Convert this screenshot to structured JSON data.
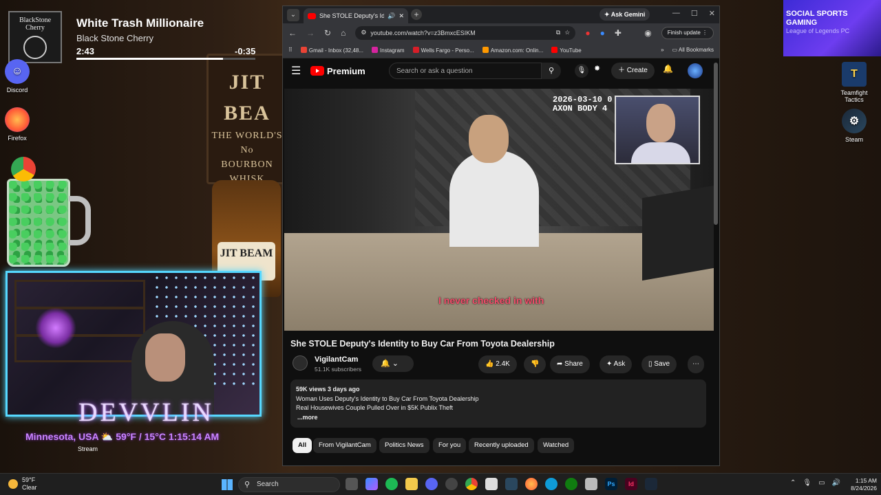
{
  "desktop": {
    "wall_sign": {
      "brand": "JIT BEA",
      "line1": "THE WORLD'S No",
      "line2": "BOURBON WHISK"
    },
    "bottle_label": "JIT BEAM",
    "icons": [
      {
        "label": "Discord"
      },
      {
        "label": "Firefox"
      },
      {
        "label": "Teamfight Tactics"
      },
      {
        "label": "Steam"
      }
    ],
    "promo": {
      "line1": "SOCIAL SPORTS",
      "line2": "GAMING",
      "line3": "League of Legends PC"
    }
  },
  "media": {
    "album_text": "BlackStone Cherry",
    "track_title": "White Trash Millionaire",
    "artist": "Black Stone Cherry",
    "elapsed": "2:43",
    "remaining": "-0:35",
    "progress": 0.82
  },
  "webcam": {
    "brand": "DEVVLIN",
    "location": "Minnesota, USA  ⛅ 59°F / 15°C  1:15:14 AM",
    "stream_label": "Stream"
  },
  "browser": {
    "tab_title": "She STOLE Deputy's Identity",
    "ask_gemini": "Ask Gemini",
    "url": "youtube.com/watch?v=z3BmxcESIKM",
    "finish_update": "Finish update",
    "bookmarks": [
      {
        "label": "Gmail - Inbox (32,48...",
        "color": "#ea4335"
      },
      {
        "label": "Instagram",
        "color": "#d6249f"
      },
      {
        "label": "Wells Fargo - Perso...",
        "color": "#d71e28"
      },
      {
        "label": "Amazon.com: Onlin...",
        "color": "#ff9900"
      },
      {
        "label": "YouTube",
        "color": "#ff0000"
      }
    ],
    "all_bookmarks": "All Bookmarks"
  },
  "youtube": {
    "logo_text": "Premium",
    "search_placeholder": "Search or ask a question",
    "create_label": "Create",
    "video": {
      "timestamp_line1": "2026-03-10 0",
      "timestamp_line2": "AXON BODY 4",
      "caption": "I never checked in with"
    },
    "title": "She STOLE Deputy's Identity to Buy Car From Toyota Dealership",
    "channel": "VigilantCam",
    "subscribers": "51.1K subscribers",
    "likes": "2.4K",
    "share_label": "Share",
    "ask_label": "Ask",
    "save_label": "Save",
    "description": {
      "meta": "59K views  3 days ago",
      "line1": "Woman Uses Deputy's Identity to Buy Car From Toyota Dealership",
      "line2": "Real Housewives Couple Pulled Over in $5K Publix Theft",
      "more": "...more"
    },
    "chips": [
      "All",
      "From VigilantCam",
      "Politics News",
      "For you",
      "Recently uploaded",
      "Watched"
    ]
  },
  "taskbar": {
    "weather_temp": "59°F",
    "weather_desc": "Clear",
    "search_placeholder": "Search",
    "time": "1:15 AM",
    "date": "8/24/2026"
  }
}
